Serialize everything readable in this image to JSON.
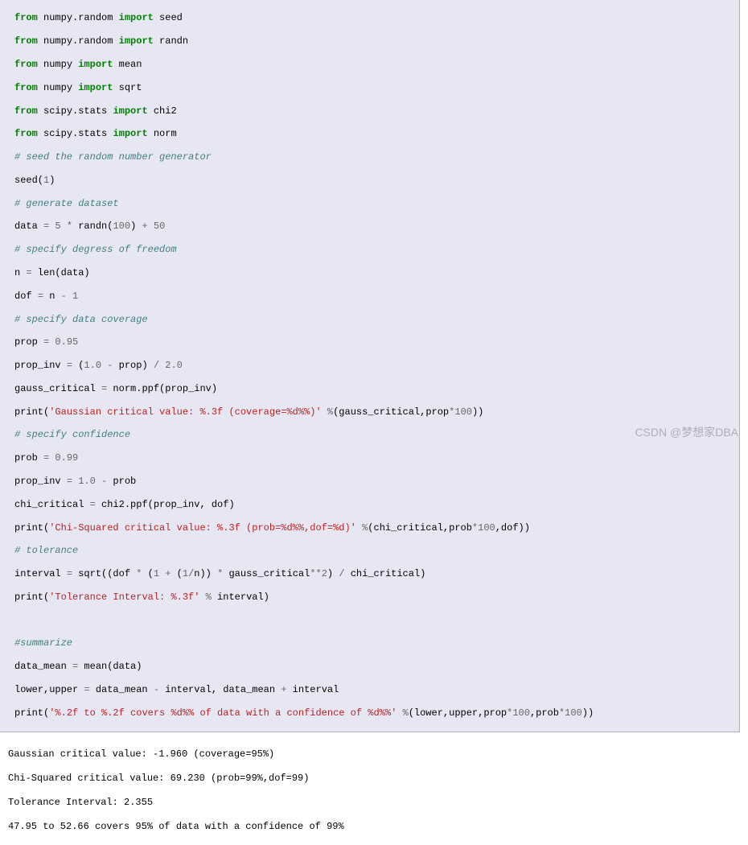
{
  "code": {
    "l01a": "from",
    "l01b": " numpy.random ",
    "l01c": "import",
    "l01d": " seed",
    "l02a": "from",
    "l02b": " numpy.random ",
    "l02c": "import",
    "l02d": " randn",
    "l03a": "from",
    "l03b": " numpy ",
    "l03c": "import",
    "l03d": " mean",
    "l04a": "from",
    "l04b": " numpy ",
    "l04c": "import",
    "l04d": " sqrt",
    "l05a": "from",
    "l05b": " scipy.stats ",
    "l05c": "import",
    "l05d": " chi2",
    "l06a": "from",
    "l06b": " scipy.stats ",
    "l06c": "import",
    "l06d": " norm",
    "l07": "# seed the random number generator",
    "l08a": "seed(",
    "l08b": "1",
    "l08c": ")",
    "l09": "# generate dataset",
    "l10a": "data ",
    "l10b": "=",
    "l10c": " ",
    "l10d": "5",
    "l10e": " ",
    "l10f": "*",
    "l10g": " randn(",
    "l10h": "100",
    "l10i": ") ",
    "l10j": "+",
    "l10k": " ",
    "l10l": "50",
    "l11": "# specify degress of freedom",
    "l12a": "n ",
    "l12b": "=",
    "l12c": " len(data)",
    "l13a": "dof ",
    "l13b": "=",
    "l13c": " n ",
    "l13d": "-",
    "l13e": " ",
    "l13f": "1",
    "l14": "# specify data coverage",
    "l15a": "prop ",
    "l15b": "=",
    "l15c": " ",
    "l15d": "0.95",
    "l16a": "prop_inv ",
    "l16b": "=",
    "l16c": " (",
    "l16d": "1.0",
    "l16e": " ",
    "l16f": "-",
    "l16g": " prop) ",
    "l16h": "/",
    "l16i": " ",
    "l16j": "2.0",
    "l17a": "gauss_critical ",
    "l17b": "=",
    "l17c": " norm.ppf(prop_inv)",
    "l18a": "print(",
    "l18b": "'Gaussian critical value: %.3f (coverage=%d%%)'",
    "l18c": " ",
    "l18d": "%",
    "l18e": "(gauss_critical,prop",
    "l18f": "*",
    "l18g": "100",
    "l18h": "))",
    "l19": "# specify confidence",
    "l20a": "prob ",
    "l20b": "=",
    "l20c": " ",
    "l20d": "0.99",
    "l21a": "prop_inv ",
    "l21b": "=",
    "l21c": " ",
    "l21d": "1.0",
    "l21e": " ",
    "l21f": "-",
    "l21g": " prob",
    "l22a": "chi_critical ",
    "l22b": "=",
    "l22c": " chi2.ppf(prop_inv, dof)",
    "l23a": "print(",
    "l23b": "'Chi-Squared critical value: %.3f (prob=%d%%,dof=%d)'",
    "l23c": " ",
    "l23d": "%",
    "l23e": "(chi_critical,prob",
    "l23f": "*",
    "l23g": "100",
    "l23h": ",dof))",
    "l24": "# tolerance",
    "l25a": "interval ",
    "l25b": "=",
    "l25c": " sqrt((dof ",
    "l25d": "*",
    "l25e": " (",
    "l25f": "1",
    "l25g": " ",
    "l25h": "+",
    "l25i": " (",
    "l25j": "1",
    "l25k": "/",
    "l25l": "n)) ",
    "l25m": "*",
    "l25n": " gauss_critical",
    "l25o": "**",
    "l25p": "2",
    "l25q": ") ",
    "l25r": "/",
    "l25s": " chi_critical)",
    "l26a": "print(",
    "l26b": "'Tolerance Interval: %.3f'",
    "l26c": " ",
    "l26d": "%",
    "l26e": " interval)",
    "l27": "",
    "l28": "#summarize",
    "l29a": "data_mean ",
    "l29b": "=",
    "l29c": " mean(data)",
    "l30a": "lower,upper ",
    "l30b": "=",
    "l30c": " data_mean ",
    "l30d": "-",
    "l30e": " interval, data_mean ",
    "l30f": "+",
    "l30g": " interval",
    "l31a": "print(",
    "l31b": "'%.2f to %.2f covers %d%% of data with a confidence of %d%%'",
    "l31c": " ",
    "l31d": "%",
    "l31e": "(lower,upper,prop",
    "l31f": "*",
    "l31g": "100",
    "l31h": ",prob",
    "l31i": "*",
    "l31j": "100",
    "l31k": "))"
  },
  "output": {
    "o1": "Gaussian critical value: -1.960 (coverage=95%)",
    "o2": "Chi-Squared critical value: 69.230 (prob=99%,dof=99)",
    "o3": "Tolerance Interval: 2.355",
    "o4": "47.95 to 52.66 covers 95% of data with a confidence of 99%"
  },
  "watermark": "CSDN @梦想家DBA"
}
